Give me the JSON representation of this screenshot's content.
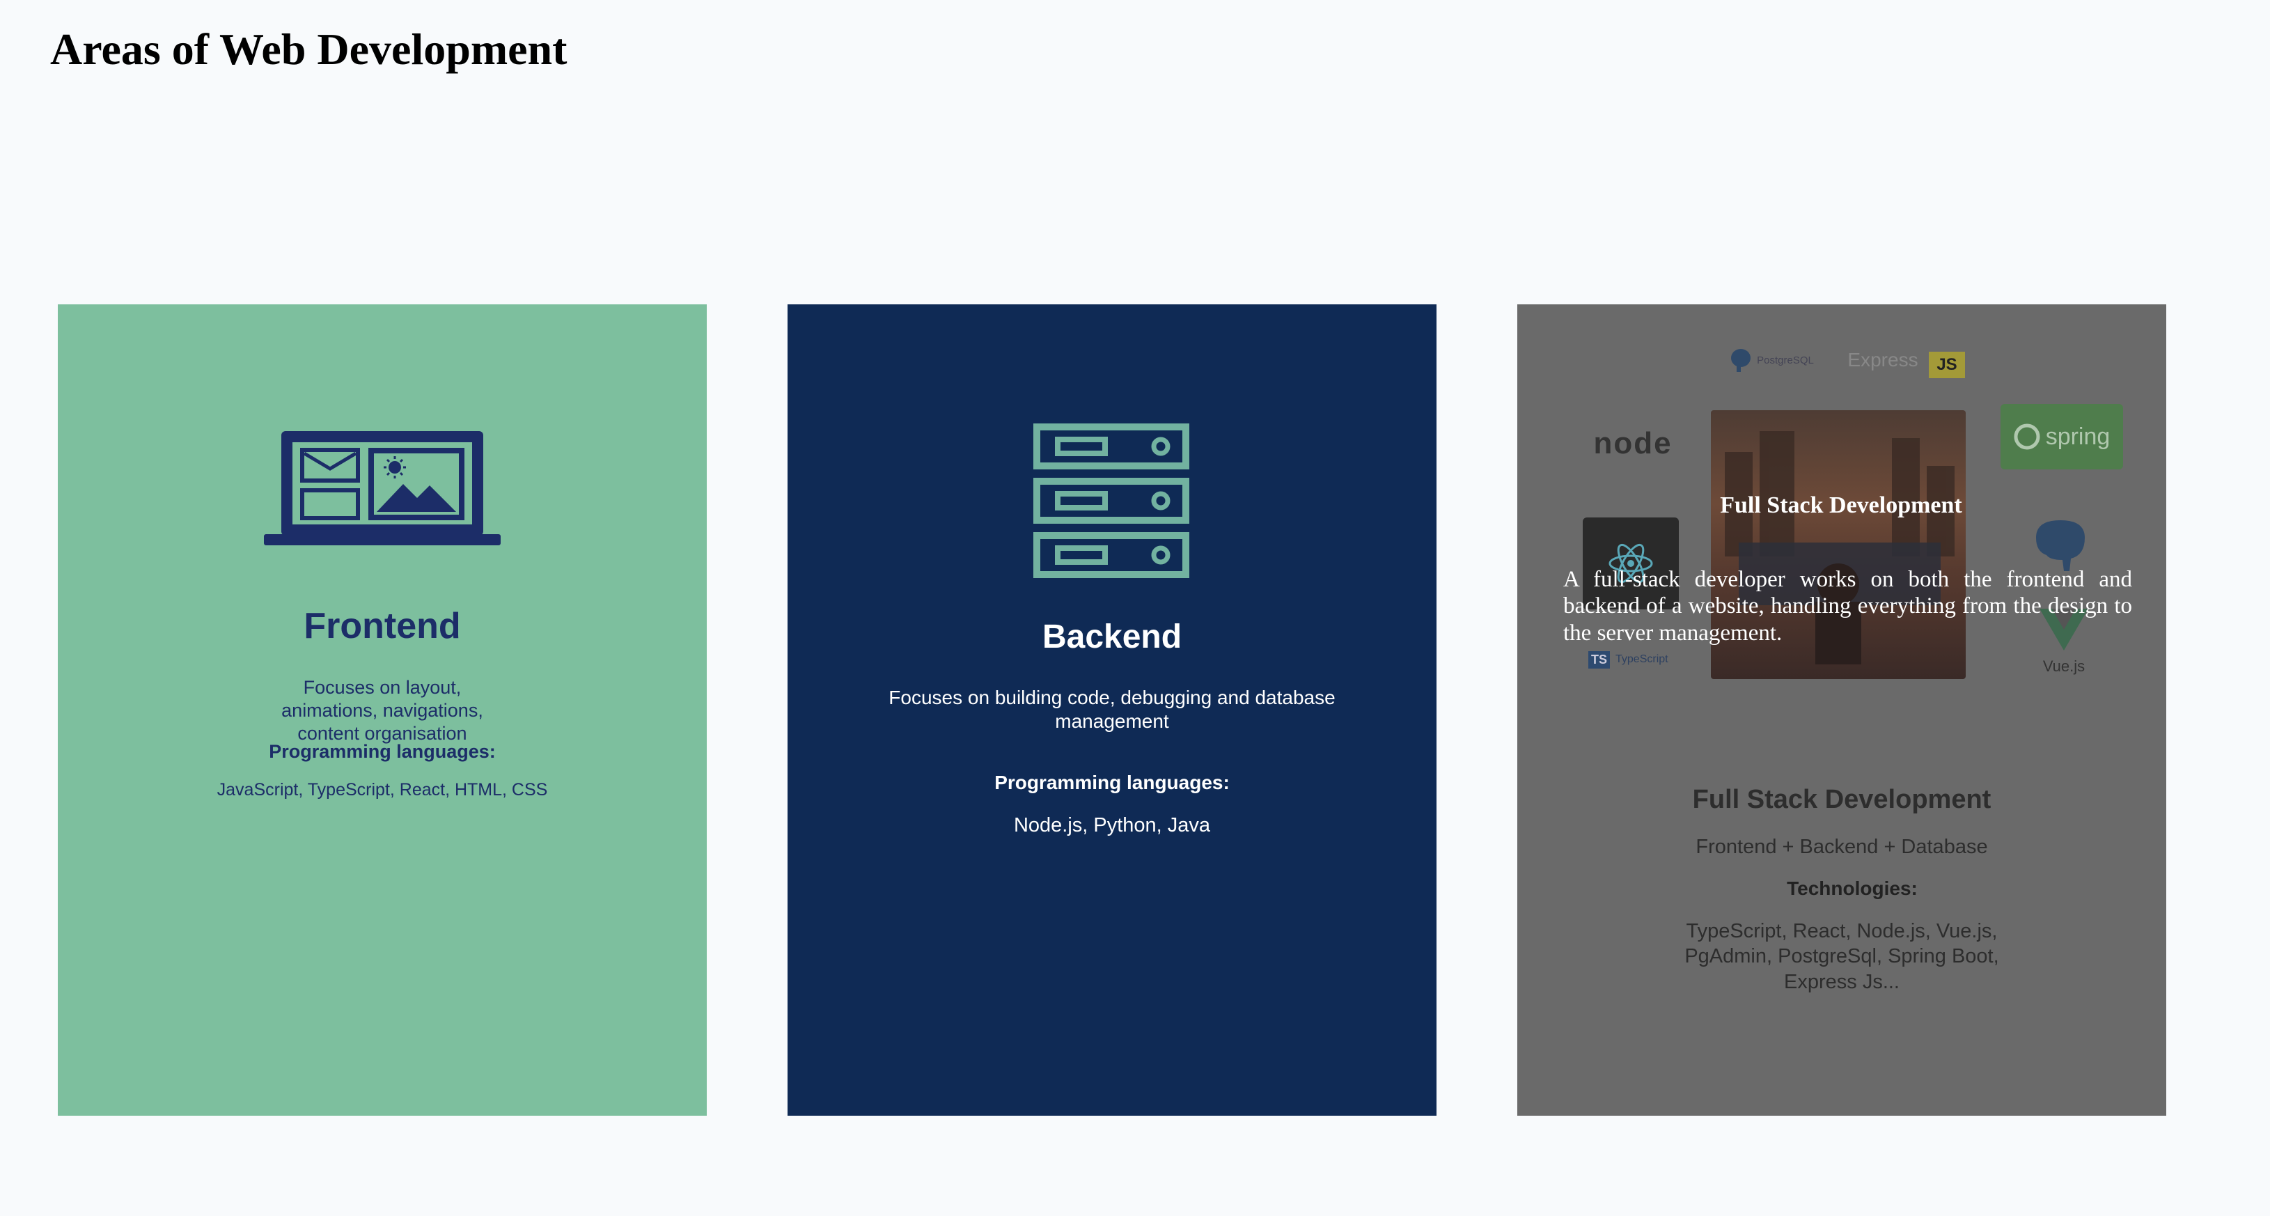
{
  "page": {
    "title": "Areas of Web Development"
  },
  "cards": {
    "frontend": {
      "heading": "Frontend",
      "description": "Focuses on layout, animations, navigations, content organisation",
      "subheading": "Programming languages:",
      "languages": "JavaScript, TypeScript, React, HTML, CSS",
      "background": "#7dbf9e",
      "text_color": "#1c2d68",
      "icon": "laptop-layout-icon"
    },
    "backend": {
      "heading": "Backend",
      "description": "Focuses on building code, debugging and database management",
      "subheading": "Programming languages:",
      "languages": "Node.js, Python, Java",
      "background": "#0f2a55",
      "text_color": "#ffffff",
      "icon": "server-stack-icon"
    },
    "fullstack": {
      "overlay_title": "Full Stack Development",
      "overlay_text": "A full-stack developer works on both the frontend and backend of a website, handling everything from the design to the server management.",
      "heading": "Full Stack Development",
      "description": "Frontend + Backend + Database",
      "subheading": "Technologies:",
      "technologies": "TypeScript, React, Node.js, Vue.js, PgAdmin, PostgreSql, Spring Boot, Express Js...",
      "background": "#6a6a6a",
      "logos": {
        "postgres": "PostgreSQL",
        "express": "Express",
        "js": "JS",
        "node": "node",
        "spring": "spring",
        "typescript": "TypeScript",
        "vue": "Vue.js"
      }
    }
  }
}
